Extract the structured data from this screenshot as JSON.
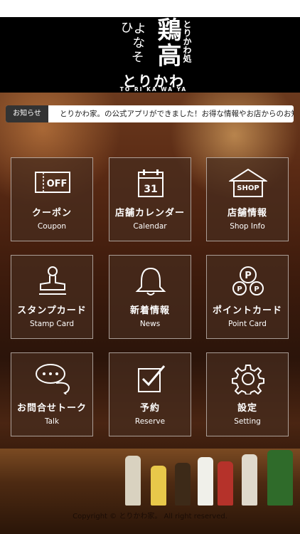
{
  "header": {
    "logo_cursive": "よなそひ",
    "logo_main": "鶏高",
    "logo_vertical": "とりかわ処",
    "logo_word": "とりかわ家。",
    "logo_romaji": "TO RI KA WA YA"
  },
  "news": {
    "label": "お知らせ",
    "text": "とりかわ家。の公式アプリができました！お得な情報やお店からのお知らせ"
  },
  "menu": [
    {
      "jp": "クーポン",
      "en": "Coupon",
      "icon": "coupon-off-icon",
      "badge": "OFF"
    },
    {
      "jp": "店舗カレンダー",
      "en": "Calendar",
      "icon": "calendar-icon",
      "badge": "31"
    },
    {
      "jp": "店舗情報",
      "en": "Shop Info",
      "icon": "shop-icon",
      "badge": "SHOP"
    },
    {
      "jp": "スタンプカード",
      "en": "Stamp Card",
      "icon": "stamp-icon"
    },
    {
      "jp": "新着情報",
      "en": "News",
      "icon": "bell-icon"
    },
    {
      "jp": "ポイントカード",
      "en": "Point Card",
      "icon": "points-icon",
      "badge": "P"
    },
    {
      "jp": "お問合せトーク",
      "en": "Talk",
      "icon": "chat-icon"
    },
    {
      "jp": "予約",
      "en": "Reserve",
      "icon": "reserve-check-icon"
    },
    {
      "jp": "設定",
      "en": "Setting",
      "icon": "gear-icon"
    }
  ],
  "footer": {
    "copyright": "Copyright © とりかわ家。 All right reserved."
  }
}
